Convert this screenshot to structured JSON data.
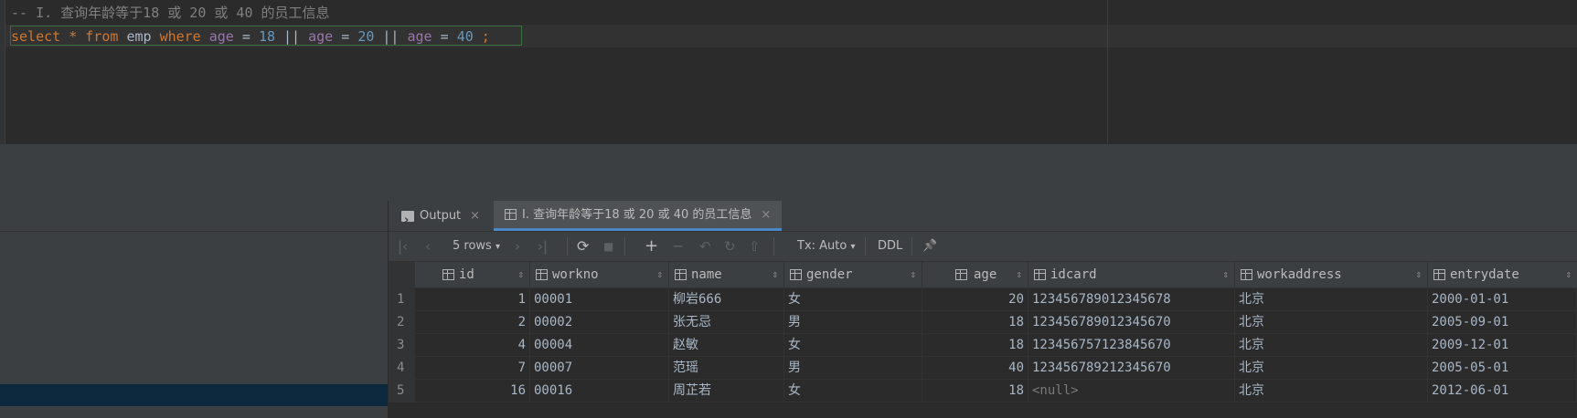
{
  "editor": {
    "comment_line": "-- I. 查询年龄等于18 或 20 或 40 的员工信息",
    "sql": {
      "select": "select",
      "star": "*",
      "from": "from",
      "table": "emp",
      "where": "where",
      "col": "age",
      "eq": "=",
      "v1": "18",
      "or": "||",
      "v2": "20",
      "v3": "40",
      "semi": ";"
    }
  },
  "tabs": {
    "output": "Output",
    "result": "I. 查询年龄等于18 或 20 或 40 的员工信息",
    "close": "×"
  },
  "toolbar": {
    "first": "|‹",
    "prev": "‹",
    "rows": "5 rows",
    "next": "›",
    "last": "›|",
    "refresh": "⟳",
    "stop": "■",
    "add": "+",
    "remove": "−",
    "revert": "↶",
    "submit": "↻",
    "up": "⇧",
    "tx": "Tx: Auto",
    "ddl": "DDL",
    "pin": "📌"
  },
  "columns": [
    "id",
    "workno",
    "name",
    "gender",
    "age",
    "idcard",
    "workaddress",
    "entrydate"
  ],
  "sort_glyph": "⇕",
  "rows": [
    {
      "n": "1",
      "id": "1",
      "workno": "00001",
      "name": "柳岩666",
      "gender": "女",
      "age": "20",
      "idcard": "123456789012345678",
      "workaddress": "北京",
      "entrydate": "2000-01-01"
    },
    {
      "n": "2",
      "id": "2",
      "workno": "00002",
      "name": "张无忌",
      "gender": "男",
      "age": "18",
      "idcard": "123456789012345670",
      "workaddress": "北京",
      "entrydate": "2005-09-01"
    },
    {
      "n": "3",
      "id": "4",
      "workno": "00004",
      "name": "赵敏",
      "gender": "女",
      "age": "18",
      "idcard": "123456757123845670",
      "workaddress": "北京",
      "entrydate": "2009-12-01"
    },
    {
      "n": "4",
      "id": "7",
      "workno": "00007",
      "name": "范瑶",
      "gender": "男",
      "age": "40",
      "idcard": "123456789212345670",
      "workaddress": "北京",
      "entrydate": "2005-05-01"
    },
    {
      "n": "5",
      "id": "16",
      "workno": "00016",
      "name": "周芷若",
      "gender": "女",
      "age": "18",
      "idcard": "<null>",
      "workaddress": "北京",
      "entrydate": "2012-06-01"
    }
  ]
}
